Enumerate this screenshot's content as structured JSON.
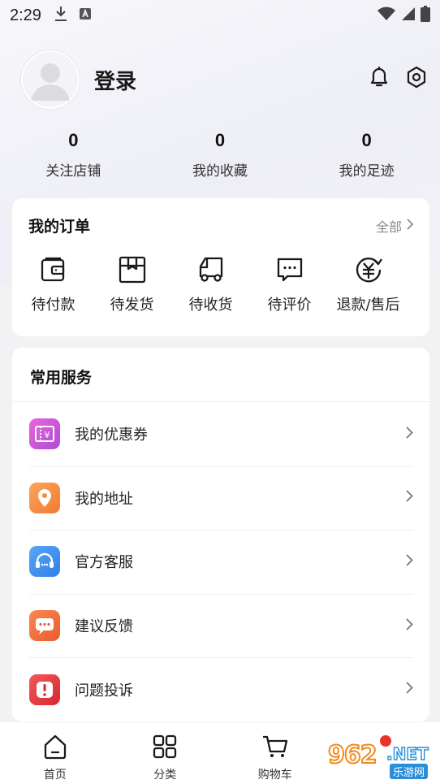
{
  "status_bar": {
    "time": "2:29"
  },
  "profile": {
    "login_label": "登录"
  },
  "stats": [
    {
      "value": "0",
      "label": "关注店铺"
    },
    {
      "value": "0",
      "label": "我的收藏"
    },
    {
      "value": "0",
      "label": "我的足迹"
    }
  ],
  "orders": {
    "title": "我的订单",
    "all_label": "全部",
    "items": [
      {
        "label": "待付款",
        "icon": "wallet-icon"
      },
      {
        "label": "待发货",
        "icon": "package-icon"
      },
      {
        "label": "待收货",
        "icon": "truck-icon"
      },
      {
        "label": "待评价",
        "icon": "comment-icon"
      },
      {
        "label": "退款/售后",
        "icon": "refund-icon"
      }
    ]
  },
  "services": {
    "title": "常用服务",
    "items": [
      {
        "label": "我的优惠券",
        "icon": "coupon-icon",
        "color": "#d14fd6"
      },
      {
        "label": "我的地址",
        "icon": "location-icon",
        "color": "#f58a3c"
      },
      {
        "label": "官方客服",
        "icon": "headset-icon",
        "color": "#3d8df0"
      },
      {
        "label": "建议反馈",
        "icon": "feedback-icon",
        "color": "#f0673a"
      },
      {
        "label": "问题投诉",
        "icon": "complaint-icon",
        "color": "#e8343a"
      }
    ]
  },
  "tabbar": {
    "items": [
      {
        "label": "首页",
        "icon": "home-icon"
      },
      {
        "label": "分类",
        "icon": "category-icon"
      },
      {
        "label": "购物车",
        "icon": "cart-icon"
      }
    ]
  },
  "watermark": {
    "digits": "962",
    "net": ".NET",
    "sub": "乐游网"
  }
}
